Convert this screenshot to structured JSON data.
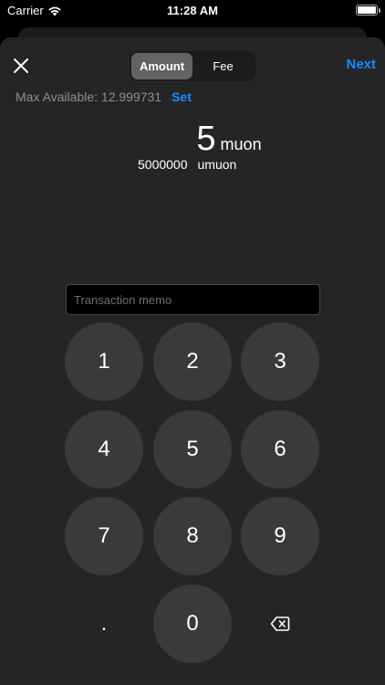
{
  "status": {
    "carrier": "Carrier",
    "time": "11:28 AM"
  },
  "header": {
    "tabs": [
      {
        "label": "Amount",
        "active": true
      },
      {
        "label": "Fee",
        "active": false
      }
    ],
    "next_label": "Next"
  },
  "balance": {
    "label": "Max Available: 12.999731",
    "set_label": "Set"
  },
  "amount": {
    "value": "5",
    "unit": "muon",
    "sub_value": "5000000",
    "sub_unit": "umuon"
  },
  "memo": {
    "placeholder": "Transaction memo",
    "value": ""
  },
  "keypad": {
    "keys": [
      "1",
      "2",
      "3",
      "4",
      "5",
      "6",
      "7",
      "8",
      "9",
      ".",
      "0"
    ]
  },
  "colors": {
    "accent": "#1a8cff",
    "sheet": "#252527",
    "key": "#3a3a3c"
  }
}
